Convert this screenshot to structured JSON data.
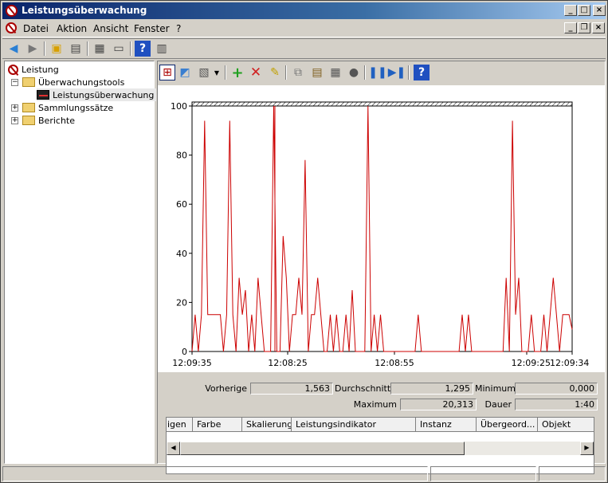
{
  "window": {
    "title": "Leistungsüberwachung"
  },
  "menubar": {
    "items": [
      "Datei",
      "Aktion",
      "Ansicht",
      "Fenster",
      "?"
    ]
  },
  "tree": {
    "root": "Leistung",
    "items": [
      {
        "label": "Überwachungstools",
        "expander": "−"
      },
      {
        "label": "Leistungsüberwachung",
        "selected": true
      },
      {
        "label": "Sammlungssätze",
        "expander": "+"
      },
      {
        "label": "Berichte",
        "expander": "+"
      }
    ]
  },
  "stats": {
    "previous_label": "Vorherige",
    "previous_value": "1,563",
    "average_label": "Durchschnitt",
    "average_value": "1,295",
    "minimum_label": "Minimum",
    "minimum_value": "0,000",
    "maximum_label": "Maximum",
    "maximum_value": "20,313",
    "duration_label": "Dauer",
    "duration_value": "1:40"
  },
  "grid": {
    "columns": [
      "igen",
      "Farbe",
      "Skalierung",
      "Leistungsindikator",
      "Instanz",
      "Übergeord...",
      "Objekt"
    ]
  },
  "colors": {
    "line": "#cc0000",
    "titlebar": "#0a246a"
  },
  "chart_data": {
    "type": "line",
    "ylim": [
      0,
      100
    ],
    "yticks": [
      0,
      20,
      40,
      60,
      80,
      100
    ],
    "xticks": [
      "12:09:35",
      "12:08:25",
      "12:08:55",
      "12:09:25",
      "12:09:34"
    ],
    "series": [
      {
        "values": [
          0,
          15,
          0,
          15,
          94,
          15,
          15,
          15,
          15,
          15,
          0,
          15,
          94,
          15,
          0,
          30,
          15,
          25,
          0,
          15,
          0,
          30,
          15,
          0,
          0,
          0,
          100,
          0,
          0,
          47,
          30,
          0,
          15,
          15,
          30,
          15,
          78,
          0,
          15,
          15,
          30,
          15,
          0,
          0,
          15,
          0,
          15,
          0,
          0,
          15,
          0,
          25,
          0,
          0,
          0,
          0,
          100,
          0,
          15,
          0,
          15,
          0,
          0,
          0,
          0,
          0,
          0,
          0,
          0,
          0,
          0,
          0,
          15,
          0,
          0,
          0,
          0,
          0,
          0,
          0,
          0,
          0,
          0,
          0,
          0,
          0,
          15,
          0,
          15,
          0,
          0,
          0,
          0,
          0,
          0,
          0,
          0,
          0,
          0,
          0,
          30,
          0,
          94,
          15,
          30,
          0,
          0,
          0,
          15,
          0,
          0,
          0,
          15,
          0,
          15,
          30,
          15,
          0,
          15,
          15,
          15,
          9
        ]
      }
    ]
  }
}
